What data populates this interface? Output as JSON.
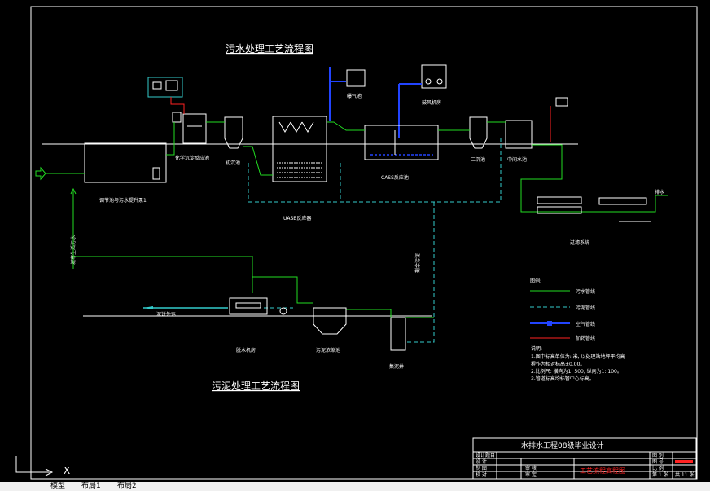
{
  "diagram": {
    "title_sewage": "污水处理工艺流程图",
    "title_sludge": "污泥处理工艺流程图",
    "labels": {
      "regulating_tank": "调节池与污水提升泵1",
      "chem_tank": "化学沉淀反应池",
      "primary_clar": "初沉池",
      "uasb": "UASB反应器",
      "aeration_tank": "曝气池",
      "blower_room": "鼓风机房",
      "cass": "CASS反应池",
      "secondary_clar": "二沉池",
      "middle_tank": "中间水池",
      "filter_system": "过滤系统",
      "discharge": "排水",
      "dewatering": "脱水机房",
      "sludge_thickener": "污泥浓缩池",
      "sump": "集泥井",
      "sludge_out": "泥饼外运",
      "left_vertical": "城市生活污水",
      "mid_vertical": "剩余污泥"
    },
    "legend": {
      "title": "图例:",
      "items": [
        {
          "label": "污水管线",
          "style": "green"
        },
        {
          "label": "污泥管线",
          "style": "cyan-dash"
        },
        {
          "label": "空气管线",
          "style": "blue"
        },
        {
          "label": "加药管线",
          "style": "red"
        }
      ]
    },
    "notes": {
      "title": "说明:",
      "lines": [
        "1.图中标高单位为: 米, 以处理站地坪平均高",
        "程作为相对标高±0.00。",
        "2.比例尺: 横向为1: 500, 纵向为1: 100。",
        "3.管道标高均标管中心标高。"
      ]
    }
  },
  "title_block": {
    "project": "水排水工程08级毕业设计",
    "drawing_name": "工艺流程高程图",
    "rows": [
      {
        "label": "设计题目",
        "value": ""
      },
      {
        "label": "设 计",
        "value": ""
      },
      {
        "label": "制 图",
        "value": "审 核"
      },
      {
        "label": "校 对",
        "value": "审 定"
      }
    ],
    "right_labels": [
      "图 别",
      "图 号",
      "比 例",
      "第 1 张"
    ],
    "right_values": [
      "",
      "",
      "",
      "共 11 张"
    ]
  },
  "tabs": [
    "模型",
    "布局1",
    "布局2"
  ],
  "ucs_label": "X",
  "colors": {
    "background": "#000000",
    "green": "#22dd22",
    "cyan": "#33cccc",
    "blue": "#2244ff",
    "red": "#ff2222"
  }
}
